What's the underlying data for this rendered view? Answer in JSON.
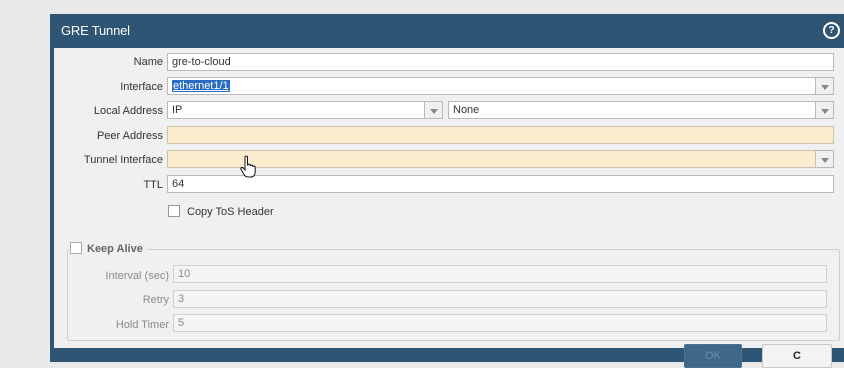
{
  "dialog": {
    "title": "GRE Tunnel",
    "help_icon": "?"
  },
  "form": {
    "name_label": "Name",
    "name_value": "gre-to-cloud",
    "interface_label": "Interface",
    "interface_value": "ethernet1/1",
    "local_address_label": "Local Address",
    "local_address_type": "IP",
    "local_address_value": "None",
    "peer_address_label": "Peer Address",
    "peer_address_value": "",
    "tunnel_interface_label": "Tunnel Interface",
    "tunnel_interface_value": "",
    "ttl_label": "TTL",
    "ttl_value": "64",
    "copy_tos_label": "Copy ToS Header",
    "copy_tos_checked": false
  },
  "keep_alive": {
    "legend": "Keep Alive",
    "enabled": false,
    "interval_label": "Interval (sec)",
    "interval_value": "10",
    "retry_label": "Retry",
    "retry_value": "3",
    "hold_timer_label": "Hold Timer",
    "hold_timer_value": "5"
  },
  "footer": {
    "ok_label": "OK",
    "cancel_label": "C"
  },
  "colors": {
    "dialog_header": "#2f5574",
    "required_field": "#fdeccd",
    "selection": "#2a6cc4"
  }
}
